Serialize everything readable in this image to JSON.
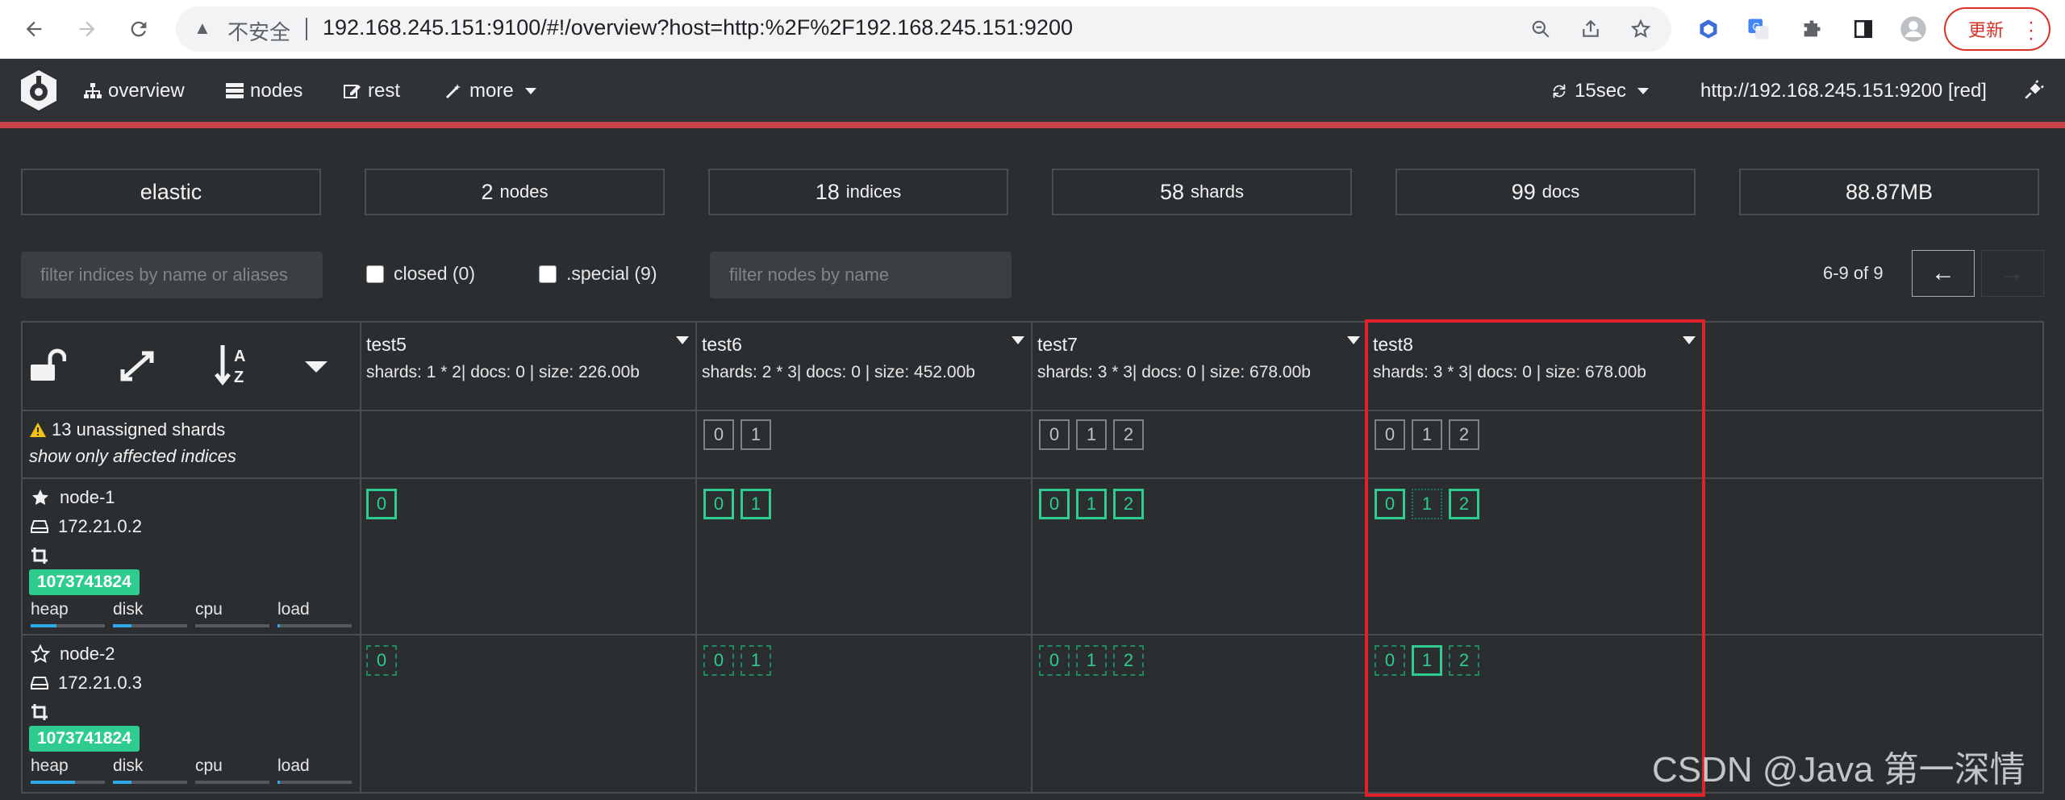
{
  "browser": {
    "insecure_label": "不安全",
    "url": "192.168.245.151:9100/#!/overview?host=http:%2F%2F192.168.245.151:9200",
    "update_label": "更新"
  },
  "topnav": {
    "overview": "overview",
    "nodes": "nodes",
    "rest": "rest",
    "more": "more",
    "refresh": "15sec",
    "cluster_url": "http://192.168.245.151:9200 [red]"
  },
  "stats": {
    "cluster_name": "elastic",
    "nodes_count": "2",
    "nodes_label": "nodes",
    "indices_count": "18",
    "indices_label": "indices",
    "shards_count": "58",
    "shards_label": "shards",
    "docs_count": "99",
    "docs_label": "docs",
    "size": "88.87MB"
  },
  "filters": {
    "indices_placeholder": "filter indices by name or aliases",
    "closed": "closed (0)",
    "special": ".special (9)",
    "nodes_placeholder": "filter nodes by name",
    "page_info": "6-9 of 9",
    "prev": "←",
    "next": "→"
  },
  "unassigned": {
    "text": "13 unassigned shards",
    "link": "show only affected indices"
  },
  "indices": [
    {
      "name": "test5",
      "meta": "shards: 1 * 2| docs: 0 | size: 226.00b"
    },
    {
      "name": "test6",
      "meta": "shards: 2 * 3| docs: 0 | size: 452.00b"
    },
    {
      "name": "test7",
      "meta": "shards: 3 * 3| docs: 0 | size: 678.00b"
    },
    {
      "name": "test8",
      "meta": "shards: 3 * 3| docs: 0 | size: 678.00b"
    }
  ],
  "nodes": [
    {
      "name": "node-1",
      "ip": "172.21.0.2",
      "badge": "1073741824",
      "metrics": [
        "heap",
        "disk",
        "cpu",
        "load"
      ],
      "levels": [
        0.35,
        0.25,
        0.0,
        0.03
      ]
    },
    {
      "name": "node-2",
      "ip": "172.21.0.3",
      "badge": "1073741824",
      "metrics": [
        "heap",
        "disk",
        "cpu",
        "load"
      ],
      "levels": [
        0.6,
        0.25,
        0.0,
        0.03
      ]
    }
  ],
  "shard_digits": [
    "0",
    "1",
    "2"
  ],
  "watermark": "CSDN @Java 第一深情",
  "colors": {
    "primary": "#2ecc8f",
    "cluster_red": "#c9434a",
    "highlight": "#e0202a"
  }
}
